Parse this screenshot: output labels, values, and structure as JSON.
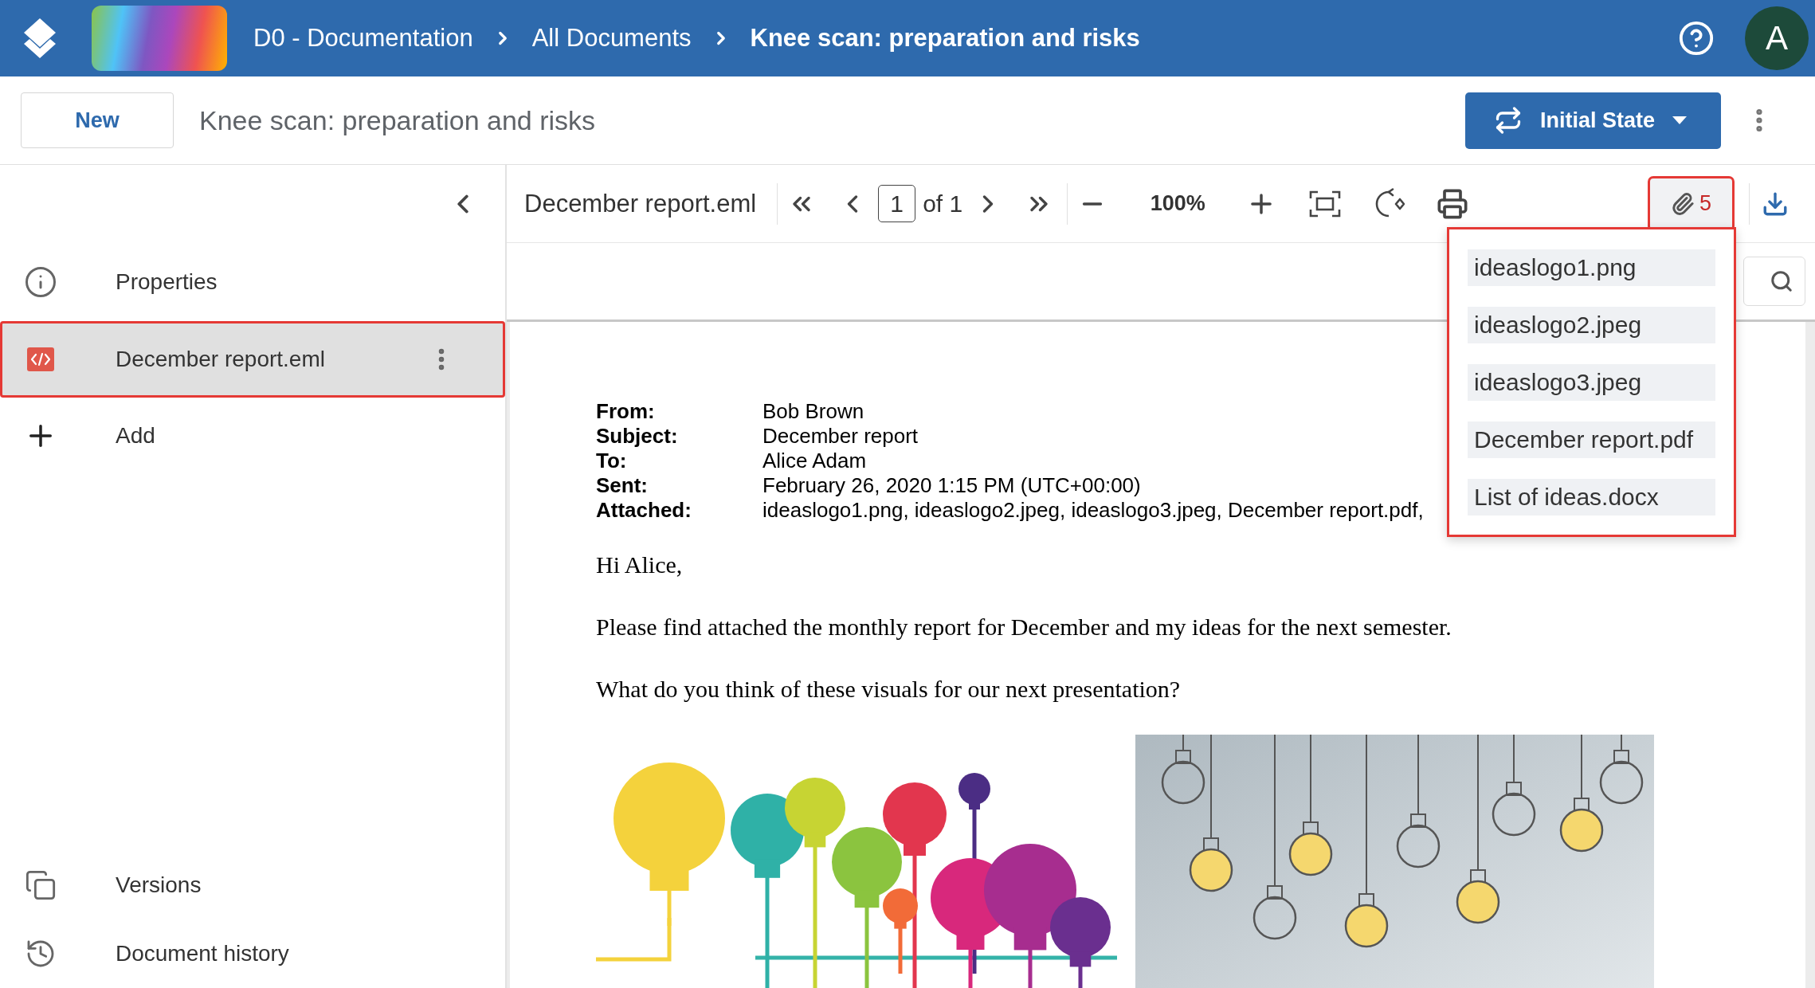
{
  "header": {
    "breadcrumbs": [
      {
        "label": "D0 - Documentation",
        "current": false
      },
      {
        "label": "All Documents",
        "current": false
      },
      {
        "label": "Knee scan: preparation and risks",
        "current": true
      }
    ],
    "avatar": "A"
  },
  "action_bar": {
    "new_button": "New",
    "title": "Knee scan: preparation and risks",
    "state_button": "Initial State"
  },
  "sidebar": {
    "items": [
      {
        "kind": "properties",
        "label": "Properties",
        "selected": false,
        "highlighted": false
      },
      {
        "kind": "file",
        "label": "December report.eml",
        "selected": true,
        "highlighted": true
      },
      {
        "kind": "add",
        "label": "Add",
        "selected": false,
        "highlighted": false
      }
    ],
    "bottom_items": [
      {
        "kind": "versions",
        "label": "Versions",
        "selected": false
      },
      {
        "kind": "history",
        "label": "Document history",
        "selected": false
      }
    ]
  },
  "viewer": {
    "file_name": "December report.eml",
    "page": "1",
    "page_total": "of 1",
    "zoom": "100%",
    "attachments": {
      "count": "5",
      "highlighted": true,
      "menu": {
        "open": true,
        "highlighted": true,
        "items": [
          "ideaslogo1.png",
          "ideaslogo2.jpeg",
          "ideaslogo3.jpeg",
          "December report.pdf",
          "List of ideas.docx"
        ]
      }
    }
  },
  "email": {
    "fields": [
      {
        "label": "From:",
        "value": "Bob Brown"
      },
      {
        "label": "Subject:",
        "value": "December report"
      },
      {
        "label": "To:",
        "value": "Alice Adam"
      },
      {
        "label": "Sent:",
        "value": "February 26, 2020 1:15 PM (UTC+00:00)"
      },
      {
        "label": "Attached:",
        "value": "ideaslogo1.png, ideaslogo2.jpeg, ideaslogo3.jpeg, December report.pdf,"
      }
    ],
    "paragraphs": [
      "Hi Alice,",
      "Please find attached the monthly report for December and my ideas for the next semester.",
      "What do you think of these visuals for our next presentation?"
    ]
  }
}
